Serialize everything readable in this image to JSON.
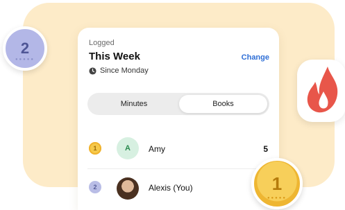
{
  "card": {
    "kicker": "Logged",
    "title": "This Week",
    "change_label": "Change",
    "since_label": "Since Monday",
    "clock_icon": "clock-icon"
  },
  "tabs": [
    {
      "label": "Minutes",
      "selected": false
    },
    {
      "label": "Books",
      "selected": true
    }
  ],
  "leaderboard": [
    {
      "rank": "1",
      "initial": "A",
      "name": "Amy",
      "score": "5"
    },
    {
      "rank": "2",
      "initial": "",
      "name": "Alexis (You)",
      "score": ""
    }
  ],
  "medals": {
    "second": "2",
    "first": "1"
  },
  "colors": {
    "backdrop": "#fdebc8",
    "accent": "#2f6fd6",
    "flame": "#e8564a",
    "gold": "#f6c94a",
    "silver": "#b3b7e7"
  }
}
